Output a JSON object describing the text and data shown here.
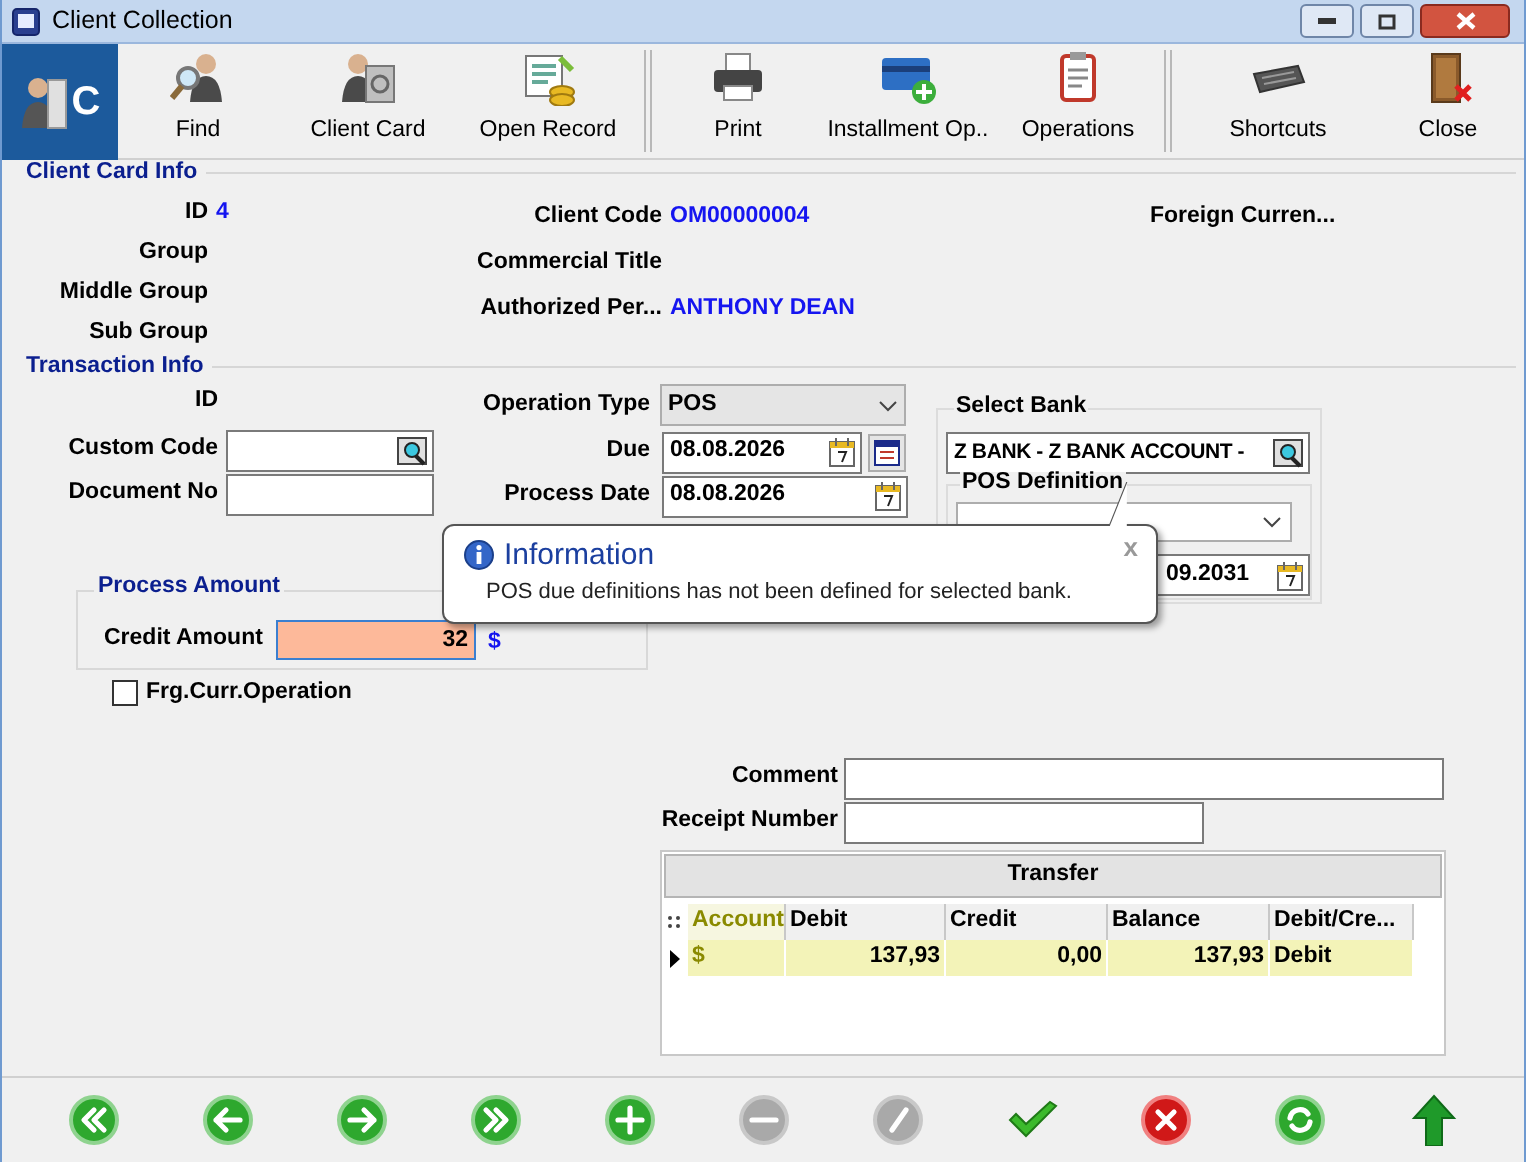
{
  "window": {
    "title": "Client Collection"
  },
  "toolbar": {
    "logo_letter": "C",
    "buttons": [
      {
        "kind": "find",
        "label": "Find",
        "separator_before": false
      },
      {
        "kind": "client_card",
        "label": "Client Card",
        "separator_before": false
      },
      {
        "kind": "open_record",
        "label": "Open Record",
        "separator_before": false
      },
      {
        "kind": "print",
        "label": "Print",
        "separator_before": true
      },
      {
        "kind": "installment",
        "label": "Installment Op..",
        "separator_before": false
      },
      {
        "kind": "operations",
        "label": "Operations",
        "separator_before": false
      },
      {
        "kind": "shortcuts",
        "label": "Shortcuts",
        "separator_before": true
      },
      {
        "kind": "close",
        "label": "Close",
        "separator_before": false
      }
    ]
  },
  "client_card_info": {
    "title": "Client Card Info",
    "left": [
      {
        "label": "ID",
        "value": "4"
      },
      {
        "label": "Group"
      },
      {
        "label": "Middle Group"
      },
      {
        "label": "Sub Group"
      }
    ],
    "middle": [
      {
        "label": "Client Code",
        "value": "OM00000004"
      },
      {
        "label": "Commercial Title"
      },
      {
        "label": "Authorized Per...",
        "value": "ANTHONY DEAN"
      }
    ],
    "right": [
      {
        "label": "Foreign Curren..."
      }
    ]
  },
  "transaction_info": {
    "title": "Transaction Info",
    "id_label": "ID",
    "custom_code": {
      "label": "Custom Code"
    },
    "document_no": {
      "label": "Document No"
    },
    "operation_type": {
      "label": "Operation Type",
      "value": "POS"
    },
    "due": {
      "label": "Due",
      "value": "08.08.2026"
    },
    "process_date": {
      "label": "Process Date",
      "value": "08.08.2026"
    },
    "select_bank": {
      "title": "Select Bank",
      "value": "Z BANK - Z BANK ACCOUNT -",
      "pos_definition": {
        "title": "POS Definition",
        "date_value": "09.2031"
      }
    },
    "process_amount": {
      "title": "Process Amount",
      "credit_label": "Credit Amount",
      "credit_value": "32",
      "currency": "$"
    },
    "foreign_currency_operation": {
      "label": "Frg.Curr.Operation",
      "checked": false
    }
  },
  "comment": {
    "label": "Comment"
  },
  "receipt_number": {
    "label": "Receipt Number"
  },
  "transfer": {
    "title": "Transfer",
    "columns": [
      "Account",
      "Debit",
      "Credit",
      "Balance",
      "Debit/Cre..."
    ],
    "rows": [
      {
        "cells": [
          "$",
          "137,93",
          "0,00",
          "137,93",
          "Debit"
        ],
        "selected": true
      }
    ]
  },
  "popup": {
    "title": "Information",
    "message": "POS due definitions has not been defined for selected bank.",
    "close": "x"
  },
  "bottom_buttons": [
    {
      "kind": "first",
      "disabled": false
    },
    {
      "kind": "previous",
      "disabled": false
    },
    {
      "kind": "next",
      "disabled": false
    },
    {
      "kind": "last",
      "disabled": false
    },
    {
      "kind": "add",
      "disabled": false
    },
    {
      "kind": "remove",
      "disabled": true
    },
    {
      "kind": "edit",
      "disabled": true
    },
    {
      "kind": "confirm",
      "disabled": false
    },
    {
      "kind": "cancel",
      "disabled": false
    },
    {
      "kind": "refresh",
      "disabled": false
    },
    {
      "kind": "up",
      "disabled": false
    }
  ]
}
